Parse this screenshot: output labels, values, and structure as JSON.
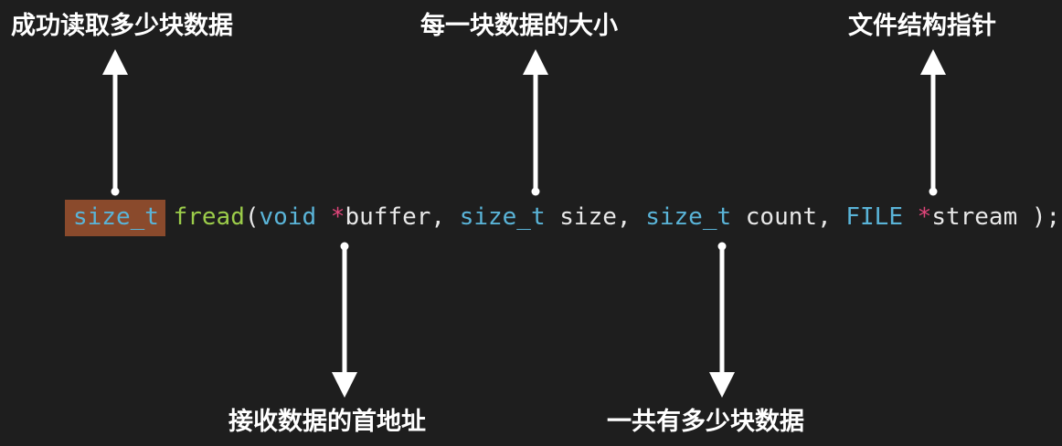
{
  "labels": {
    "return_value": "成功读取多少块数据",
    "size": "每一块数据的大小",
    "stream": "文件结构指针",
    "buffer": "接收数据的首地址",
    "count": "一共有多少块数据"
  },
  "code": {
    "return_type": "size_t",
    "function_name": "fread",
    "open_paren": "(",
    "p1_type": "void",
    "p1_star": "*",
    "p1_name": "buffer",
    "sep1": ", ",
    "p2_type": "size_t",
    "p2_name": "size",
    "sep2": ", ",
    "p3_type": "size_t",
    "p3_name": "count",
    "sep3": ", ",
    "p4_type": "FILE",
    "p4_star": "*",
    "p4_name": "stream",
    "close": " );"
  },
  "colors": {
    "background": "#1e1e1e",
    "highlight": "#8a4a2c",
    "type": "#5ab4d8",
    "function": "#9ccd4a",
    "pointer": "#e0457a",
    "text": "#e8e8e8",
    "arrow": "#ffffff"
  }
}
